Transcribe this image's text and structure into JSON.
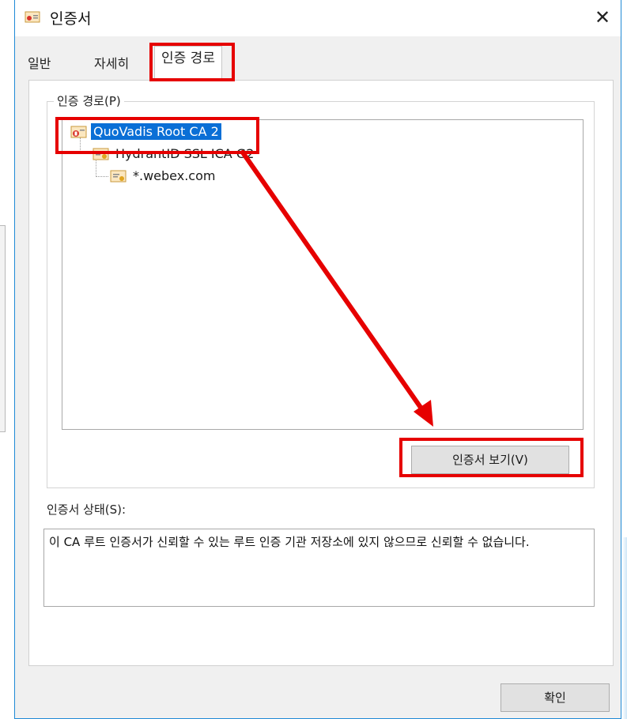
{
  "window": {
    "title": "인증서",
    "close_glyph": "✕"
  },
  "tabs": [
    {
      "label": "일반",
      "active": false
    },
    {
      "label": "자세히",
      "active": false
    },
    {
      "label": "인증 경로",
      "active": true
    }
  ],
  "cert_path": {
    "group_label": "인증 경로(P)",
    "items": [
      {
        "label": "QuoVadis Root CA 2",
        "level": 0,
        "selected": true,
        "icon": "cert-warning-icon"
      },
      {
        "label": "HydrantID SSL ICA G2",
        "level": 1,
        "selected": false,
        "icon": "cert-icon"
      },
      {
        "label": "*.webex.com",
        "level": 2,
        "selected": false,
        "icon": "cert-icon"
      }
    ],
    "view_button": "인증서 보기(V)"
  },
  "status": {
    "label": "인증서 상태(S):",
    "text": "이 CA 루트 인증서가 신뢰할 수 있는 루트 인증 기관 저장소에 있지 않으므로 신뢰할 수 없습니다."
  },
  "ok_button": "확인",
  "colors": {
    "annotation": "#e60000",
    "selection": "#0a6fd6",
    "window_border": "#1f8ad6"
  }
}
